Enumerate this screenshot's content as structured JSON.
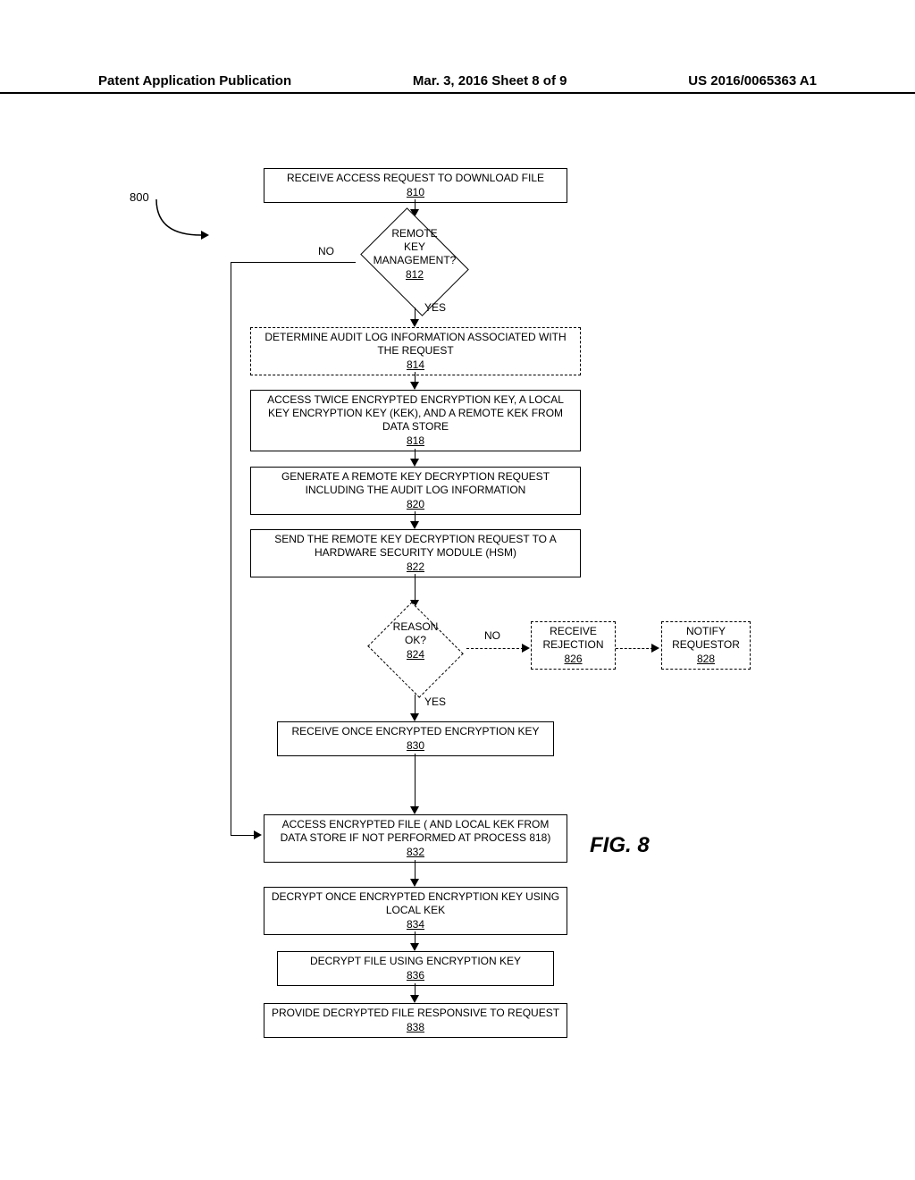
{
  "header": {
    "left": "Patent Application Publication",
    "center": "Mar. 3, 2016  Sheet 8 of 9",
    "right": "US 2016/0065363 A1"
  },
  "flow": {
    "ref800": "800",
    "b810": {
      "text": "RECEIVE ACCESS REQUEST TO DOWNLOAD FILE",
      "ref": "810"
    },
    "d812": {
      "l1": "REMOTE",
      "l2": "KEY",
      "l3": "MANAGEMENT?",
      "ref": "812"
    },
    "no812": "NO",
    "yes812": "YES",
    "b814": {
      "text": "DETERMINE AUDIT LOG INFORMATION ASSOCIATED WITH THE REQUEST",
      "ref": "814"
    },
    "b818": {
      "text": "ACCESS TWICE ENCRYPTED ENCRYPTION KEY, A LOCAL KEY ENCRYPTION KEY (KEK), AND A REMOTE KEK FROM DATA STORE",
      "ref": "818"
    },
    "b820": {
      "text": "GENERATE A REMOTE KEY DECRYPTION REQUEST INCLUDING THE AUDIT LOG INFORMATION",
      "ref": "820"
    },
    "b822": {
      "text": "SEND THE REMOTE KEY DECRYPTION REQUEST TO A HARDWARE SECURITY MODULE (HSM)",
      "ref": "822"
    },
    "d824": {
      "l1": "REASON",
      "l2": "OK?",
      "ref": "824"
    },
    "no824": "NO",
    "yes824": "YES",
    "b826": {
      "l1": "RECEIVE",
      "l2": "REJECTION",
      "ref": "826"
    },
    "b828": {
      "l1": "NOTIFY",
      "l2": "REQUESTOR",
      "ref": "828"
    },
    "b830": {
      "text": "RECEIVE ONCE ENCRYPTED ENCRYPTION KEY",
      "ref": "830"
    },
    "b832": {
      "text": "ACCESS ENCRYPTED FILE ( AND LOCAL KEK FROM DATA STORE IF NOT PERFORMED AT PROCESS 818)",
      "ref": "832"
    },
    "b834": {
      "text": "DECRYPT ONCE ENCRYPTED ENCRYPTION KEY USING LOCAL KEK",
      "ref": "834"
    },
    "b836": {
      "text": "DECRYPT FILE USING ENCRYPTION KEY",
      "ref": "836"
    },
    "b838": {
      "text": "PROVIDE DECRYPTED FILE RESPONSIVE TO REQUEST",
      "ref": "838"
    }
  },
  "fig": "FIG. 8"
}
